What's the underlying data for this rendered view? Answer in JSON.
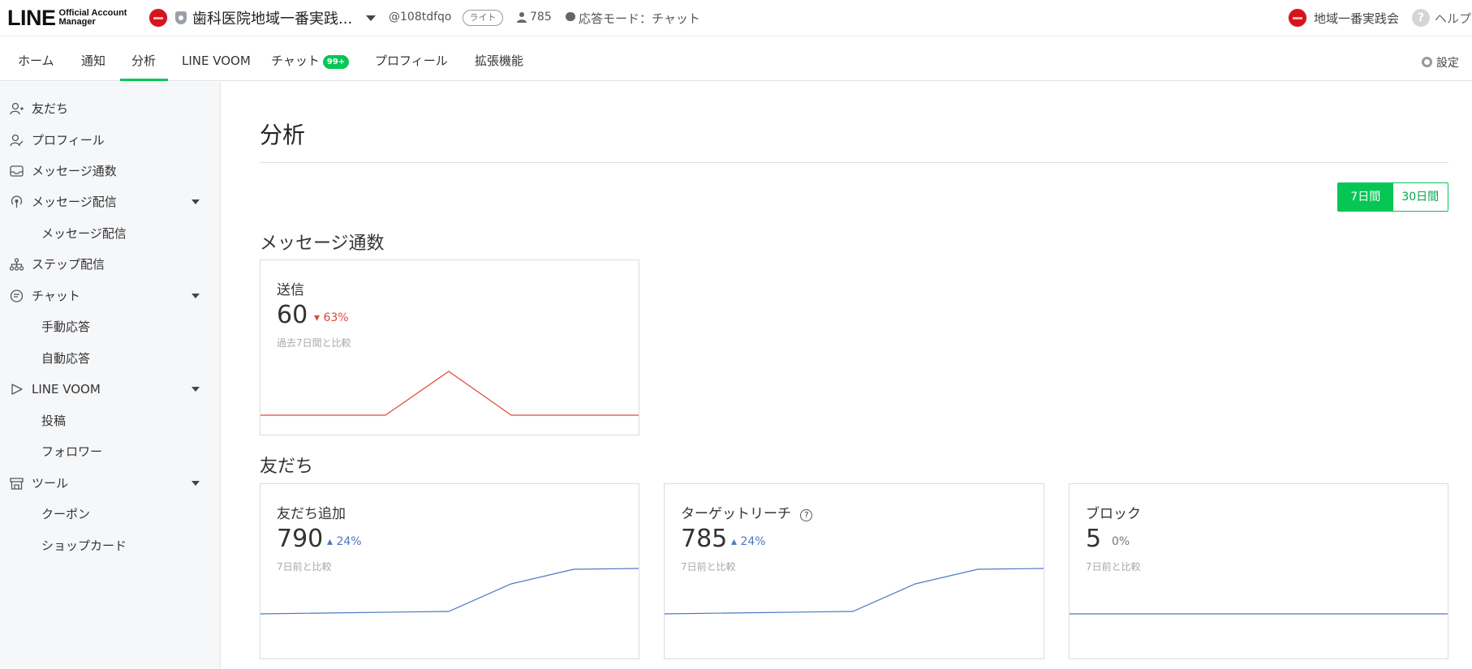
{
  "header": {
    "logo_main": "LINE",
    "logo_sub_1": "Official Account",
    "logo_sub_2": "Manager",
    "account_name": "歯科医院地域一番実践...",
    "account_id": "@108tdfqo",
    "plan_badge": "ライト",
    "friend_count": "785",
    "response_mode": "応答モード：チャット",
    "right_account_name": "地域一番実践会",
    "help_label": "ヘルプ",
    "help_glyph": "?"
  },
  "nav": {
    "items": [
      {
        "label": "ホーム"
      },
      {
        "label": "通知"
      },
      {
        "label": "分析"
      },
      {
        "label": "LINE VOOM"
      },
      {
        "label": "チャット",
        "badge": "99+"
      },
      {
        "label": "プロフィール"
      },
      {
        "label": "拡張機能"
      }
    ],
    "active": "分析",
    "settings_label": "設定"
  },
  "sidebar": {
    "items": [
      {
        "label": "友だち",
        "icon": "add-friend-icon"
      },
      {
        "label": "プロフィール",
        "icon": "profile-icon"
      },
      {
        "label": "メッセージ通数",
        "icon": "inbox-icon"
      },
      {
        "label": "メッセージ配信",
        "icon": "broadcast-icon"
      },
      {
        "label": "メッセージ配信"
      },
      {
        "label": "ステップ配信",
        "icon": "step-icon"
      },
      {
        "label": "チャット",
        "icon": "chat-icon"
      },
      {
        "label": "手動応答"
      },
      {
        "label": "自動応答"
      },
      {
        "label": "LINE VOOM",
        "icon": "voom-icon"
      },
      {
        "label": "投稿"
      },
      {
        "label": "フォロワー"
      },
      {
        "label": "ツール",
        "icon": "store-icon"
      },
      {
        "label": "クーポン"
      },
      {
        "label": "ショップカード"
      }
    ]
  },
  "main": {
    "title": "分析",
    "range_options": [
      "7日間",
      "30日間"
    ],
    "range_selected": "7日間",
    "sections": {
      "messages": "メッセージ通数",
      "friends": "友だち"
    },
    "cards": {
      "sent": {
        "label": "送信",
        "value": "60",
        "change": "63%",
        "direction": "down",
        "note": "過去7日間と比較"
      },
      "friends_added": {
        "label": "友だち追加",
        "value": "790",
        "change": "24%",
        "direction": "up",
        "note": "7日前と比較"
      },
      "target_reach": {
        "label": "ターゲットリーチ",
        "value": "785",
        "change": "24%",
        "direction": "up",
        "note": "7日前と比較"
      },
      "blocks": {
        "label": "ブロック",
        "value": "5",
        "change": "0%",
        "direction": "flat",
        "note": "7日前と比較"
      }
    }
  },
  "colors": {
    "brand_green": "#06c755",
    "down_red": "#e0463a",
    "up_blue": "#4a78c4",
    "badge_red": "#d7141c"
  }
}
